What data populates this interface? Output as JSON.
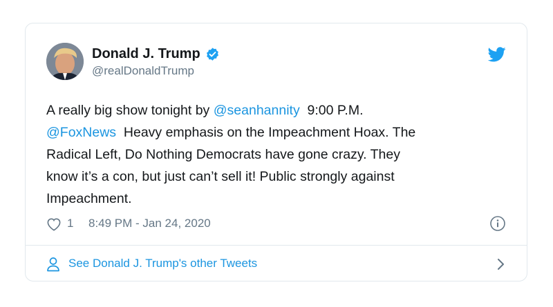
{
  "tweet": {
    "display_name": "Donald J. Trump",
    "handle": "@realDonaldTrump",
    "verified": true,
    "body": [
      {
        "text": "A really big show tonight by ",
        "type": "text"
      },
      {
        "text": "@seanhannity",
        "type": "mention"
      },
      {
        "text": "  9:00 P.M.\n",
        "type": "text"
      },
      {
        "text": "@FoxNews",
        "type": "mention"
      },
      {
        "text": "  Heavy emphasis on the Impeachment Hoax. The\nRadical Left, Do Nothing Democrats have gone crazy. They\nknow it’s a con, but just can’t sell it! Public strongly against\nImpeachment.",
        "type": "text"
      }
    ],
    "like_count": "1",
    "timestamp": "8:49 PM - Jan 24, 2020"
  },
  "footer": {
    "link_text": "See Donald J. Trump's other Tweets"
  },
  "icons": {
    "brand": "twitter-bird-icon",
    "verified": "verified-badge-icon",
    "like": "heart-icon",
    "info": "info-icon",
    "profile": "person-icon",
    "chevron": "chevron-right-icon"
  },
  "colors": {
    "accent": "#1da1f2",
    "link": "#1b95e0",
    "secondary_text": "#657786",
    "border": "#e1e8ed"
  }
}
